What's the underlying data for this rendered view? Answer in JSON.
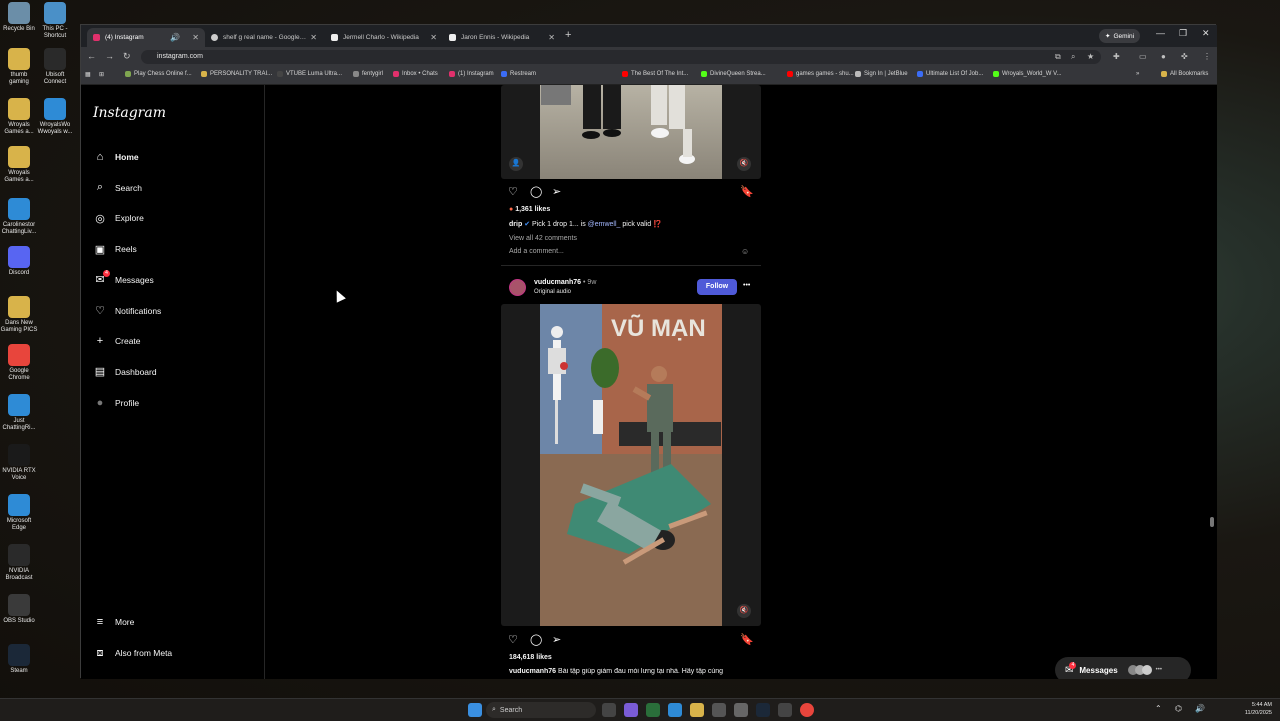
{
  "desktop": {
    "icons": [
      {
        "label": "Recycle Bin",
        "icon": "recycle-bin-icon",
        "color": "#6b8ea8"
      },
      {
        "label": "This PC - Shortcut",
        "icon": "computer-icon",
        "color": "#4a90c8"
      },
      {
        "label": "thumb gaming",
        "icon": "folder-icon",
        "color": "#d8b34a"
      },
      {
        "label": "Ubisoft Connect",
        "icon": "ubisoft-icon",
        "color": "#2a2a2a"
      },
      {
        "label": "Wroyals Games a...",
        "icon": "folder-icon",
        "color": "#d8b34a"
      },
      {
        "label": "WroyalsWo Wwoyals w...",
        "icon": "edge-icon",
        "color": "#2e8bd6"
      },
      {
        "label": "Wroyals Games a...",
        "icon": "folder-icon",
        "color": "#d8b34a"
      },
      {
        "label": "Carolinestor ChattingLiv...",
        "icon": "edge-icon",
        "color": "#2e8bd6"
      },
      {
        "label": "Discord",
        "icon": "discord-icon",
        "color": "#5865f2"
      },
      {
        "label": "Dans New Gaming PICS",
        "icon": "folder-icon",
        "color": "#d8b34a"
      },
      {
        "label": "Google Chrome",
        "icon": "chrome-icon",
        "color": "#e8453c"
      },
      {
        "label": "Just ChattingRi...",
        "icon": "edge-icon",
        "color": "#2e8bd6"
      },
      {
        "label": "NVIDIA RTX Voice",
        "icon": "nvidia-icon",
        "color": "#1a1a1a"
      },
      {
        "label": "Microsoft Edge",
        "icon": "edge-icon",
        "color": "#2e8bd6"
      },
      {
        "label": "NVIDIA Broadcast",
        "icon": "nvidia-icon",
        "color": "#2a2a2a"
      },
      {
        "label": "OBS Studio",
        "icon": "obs-icon",
        "color": "#3a3a3a"
      },
      {
        "label": "Steam",
        "icon": "steam-icon",
        "color": "#1b2838"
      }
    ]
  },
  "browser": {
    "tabs": [
      {
        "label": "(4) Instagram",
        "active": true,
        "fav_color": "#e1306c"
      },
      {
        "label": "shelf g real name - Google Sea...",
        "active": false,
        "fav_color": "#cccccc"
      },
      {
        "label": "Jermell Charlo - Wikipedia",
        "active": false,
        "fav_color": "#eeeeee"
      },
      {
        "label": "Jaron Ennis - Wikipedia",
        "active": false,
        "fav_color": "#eeeeee"
      }
    ],
    "new_tab": "+",
    "gemini_label": "Gemini",
    "url": "instagram.com",
    "bookmarks": [
      {
        "label": "Play Chess Online f...",
        "color": "#7fa650"
      },
      {
        "label": "PERSONALITY TRAI...",
        "color": "#d8b34a"
      },
      {
        "label": "VTUBE Luma Ultra...",
        "color": "#444444"
      },
      {
        "label": "fentygirl",
        "color": "#888888"
      },
      {
        "label": "Inbox • Chats",
        "color": "#e1306c"
      },
      {
        "label": "(1) Instagram",
        "color": "#e1306c"
      },
      {
        "label": "Restream",
        "color": "#3b6cf5"
      },
      {
        "label": "The Best Of The Int...",
        "color": "#ff0000"
      },
      {
        "label": "DivineQueen Strea...",
        "color": "#53fc18"
      },
      {
        "label": "games games - shu...",
        "color": "#ff0000"
      },
      {
        "label": "Sign In | JetBlue",
        "color": "#bbbbbb"
      },
      {
        "label": "Ultimate List Of Job...",
        "color": "#3b6cf5"
      },
      {
        "label": "Wroyals_World_W V...",
        "color": "#53fc18"
      }
    ],
    "all_bookmarks": "All Bookmarks"
  },
  "instagram": {
    "logo": "Instagram",
    "nav": [
      {
        "label": "Home",
        "icon": "home-icon",
        "bold": true
      },
      {
        "label": "Search",
        "icon": "search-icon",
        "bold": false
      },
      {
        "label": "Explore",
        "icon": "compass-icon",
        "bold": false
      },
      {
        "label": "Reels",
        "icon": "reels-icon",
        "bold": false
      },
      {
        "label": "Messages",
        "icon": "messenger-icon",
        "bold": false,
        "badge": "4"
      },
      {
        "label": "Notifications",
        "icon": "heart-icon",
        "bold": false
      },
      {
        "label": "Create",
        "icon": "plus-icon",
        "bold": false
      },
      {
        "label": "Dashboard",
        "icon": "dashboard-icon",
        "bold": false
      },
      {
        "label": "Profile",
        "icon": "avatar-icon",
        "bold": false
      }
    ],
    "bottom_nav": [
      {
        "label": "More",
        "icon": "menu-icon"
      },
      {
        "label": "Also from Meta",
        "icon": "meta-icon"
      }
    ],
    "post1": {
      "likes": "1,361 likes",
      "caption_user": "drip",
      "caption_text": "Pick 1 drop 1... is ",
      "caption_mention": "@emwell_",
      "caption_tail": " pick valid ⁉️",
      "view_comments": "View all 42 comments",
      "add_comment": "Add a comment..."
    },
    "post2": {
      "username": "vuducmanh76",
      "time": "• 9w",
      "audio": "Original audio",
      "follow": "Follow",
      "more": "•••",
      "sign_text": "VŨ MẠN",
      "likes": "184,618 likes",
      "caption_user": "vuducmanh76",
      "caption_text": "Bài tập giúp giảm đau mỏi lưng tại nhà. Hãy tập cùng"
    },
    "messages_pill": {
      "label": "Messages",
      "badge": "4",
      "more": "•••"
    }
  },
  "taskbar": {
    "search_label": "Search",
    "time": "5:44 AM",
    "date": "11/20/2025"
  }
}
